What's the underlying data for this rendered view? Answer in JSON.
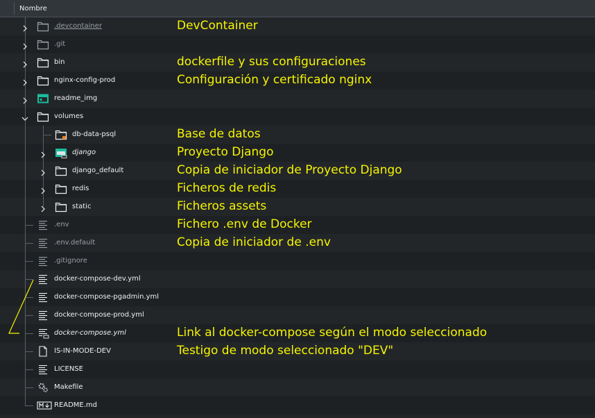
{
  "header": {
    "column_name": "Nombre"
  },
  "colors": {
    "background": "#232629",
    "annotation": "#f5f500",
    "text": "#eff0f1",
    "dim_text": "#9aa0a6",
    "accent_folder": "#1abc9c"
  },
  "rows": [
    {
      "name": ".devcontainer",
      "note": "DevContainer"
    },
    {
      "name": ".git",
      "note": ""
    },
    {
      "name": "bin",
      "note": "dockerfile y sus configuraciones"
    },
    {
      "name": "nginx-config-prod",
      "note": "Configuración y certificado nginx"
    },
    {
      "name": "readme_img",
      "note": ""
    },
    {
      "name": "volumes",
      "note": ""
    },
    {
      "name": "db-data-psql",
      "note": "Base de datos"
    },
    {
      "name": "django",
      "note": "Proyecto Django"
    },
    {
      "name": "django_default",
      "note": "Copia de iniciador de Proyecto Django"
    },
    {
      "name": "redis",
      "note": "Ficheros de redis"
    },
    {
      "name": "static",
      "note": "Ficheros assets"
    },
    {
      "name": ".env",
      "note": "Fichero .env de Docker"
    },
    {
      "name": ".env.default",
      "note": "Copia de iniciador de .env"
    },
    {
      "name": ".gitignore",
      "note": ""
    },
    {
      "name": "docker-compose-dev.yml",
      "note": ""
    },
    {
      "name": "docker-compose-pgadmin.yml",
      "note": ""
    },
    {
      "name": "docker-compose-prod.yml",
      "note": ""
    },
    {
      "name": "docker-compose.yml",
      "note": "Link al docker-compose según el modo seleccionado"
    },
    {
      "name": "IS-IN-MODE-DEV",
      "note": "Testigo de modo seleccionado \"DEV\""
    },
    {
      "name": "LICENSE",
      "note": ""
    },
    {
      "name": "Makefile",
      "note": ""
    },
    {
      "name": "README.md",
      "note": ""
    }
  ],
  "icons": {
    "folder": "folder-icon",
    "image_folder": "image-folder-icon",
    "locked_folder": "locked-folder-icon",
    "linked_folder": "linked-folder-icon",
    "text_file": "text-file-icon",
    "linked_text_file": "linked-text-file-icon",
    "blank_file": "blank-file-icon",
    "makefile": "gear-file-icon",
    "markdown": "markdown-file-icon"
  }
}
